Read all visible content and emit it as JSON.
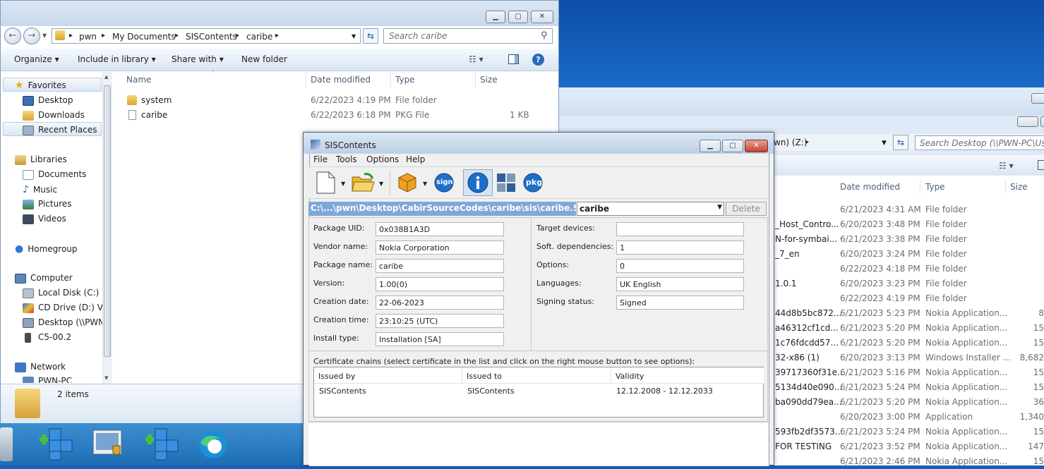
{
  "left_explorer": {
    "breadcrumbs": [
      "pwn",
      "My Documents",
      "SISContents",
      "caribe"
    ],
    "search_placeholder": "Search caribe",
    "commands": [
      "Organize",
      "Include in library",
      "Share with",
      "New folder"
    ],
    "nav": {
      "favorites": "Favorites",
      "favorites_items": [
        "Desktop",
        "Downloads",
        "Recent Places"
      ],
      "libraries": "Libraries",
      "libraries_items": [
        "Documents",
        "Music",
        "Pictures",
        "Videos"
      ],
      "homegroup": "Homegroup",
      "computer": "Computer",
      "computer_items": [
        "Local Disk (C:)",
        "CD Drive (D:) Virt",
        "Desktop (\\\\PWN-",
        "C5-00.2"
      ],
      "network": "Network",
      "network_items": [
        "PWN-PC"
      ]
    },
    "columns": {
      "name": "Name",
      "date": "Date modified",
      "type": "Type",
      "size": "Size"
    },
    "files": [
      {
        "name": "system",
        "date": "6/22/2023 4:19 PM",
        "type": "File folder",
        "size": ""
      },
      {
        "name": "caribe",
        "date": "6/22/2023 6:18 PM",
        "type": "PKG File",
        "size": "1 KB"
      }
    ],
    "status": "2 items"
  },
  "right_explorer": {
    "address_fragment": "wn) (Z:)",
    "search_placeholder": "Search Desktop (\\\\PWN-PC\\Users",
    "columns": {
      "date": "Date modified",
      "type": "Type",
      "size": "Size"
    },
    "rows": [
      {
        "name": "",
        "date": "6/21/2023 4:31 AM",
        "type": "File folder",
        "size": ""
      },
      {
        "name": "_Host_Contro...",
        "date": "6/20/2023 3:48 PM",
        "type": "File folder",
        "size": ""
      },
      {
        "name": "N-for-symbai...",
        "date": "6/21/2023 3:38 PM",
        "type": "File folder",
        "size": ""
      },
      {
        "name": "_7_en",
        "date": "6/20/2023 3:24 PM",
        "type": "File folder",
        "size": ""
      },
      {
        "name": "",
        "date": "6/22/2023 4:18 PM",
        "type": "File folder",
        "size": ""
      },
      {
        "name": "1.0.1",
        "date": "6/20/2023 3:23 PM",
        "type": "File folder",
        "size": ""
      },
      {
        "name": "",
        "date": "6/22/2023 4:19 PM",
        "type": "File folder",
        "size": ""
      },
      {
        "name": "44d8b5bc872...",
        "date": "6/21/2023 5:23 PM",
        "type": "Nokia Application...",
        "size": "8"
      },
      {
        "name": "a46312cf1cd...",
        "date": "6/21/2023 5:20 PM",
        "type": "Nokia Application...",
        "size": "15"
      },
      {
        "name": "1c76fdcdd57...",
        "date": "6/21/2023 5:20 PM",
        "type": "Nokia Application...",
        "size": "15"
      },
      {
        "name": "32-x86 (1)",
        "date": "6/20/2023 3:13 PM",
        "type": "Windows Installer ...",
        "size": "8,682"
      },
      {
        "name": "39717360f31e...",
        "date": "6/21/2023 5:16 PM",
        "type": "Nokia Application...",
        "size": "15"
      },
      {
        "name": "5134d40e090...",
        "date": "6/21/2023 5:24 PM",
        "type": "Nokia Application...",
        "size": "15"
      },
      {
        "name": "ba090dd79ea...",
        "date": "6/21/2023 5:20 PM",
        "type": "Nokia Application...",
        "size": "36"
      },
      {
        "name": "",
        "date": "6/20/2023 3:00 PM",
        "type": "Application",
        "size": "1,340"
      },
      {
        "name": "593fb2df3573...",
        "date": "6/21/2023 5:24 PM",
        "type": "Nokia Application...",
        "size": "15"
      },
      {
        "name": "FOR TESTING",
        "date": "6/21/2023 3:52 PM",
        "type": "Nokia Application...",
        "size": "147"
      },
      {
        "name": "",
        "date": "6/21/2023 2:46 PM",
        "type": "Nokia Application...",
        "size": "15"
      }
    ]
  },
  "sis": {
    "title": "SISContents",
    "menu": [
      "File",
      "Tools",
      "Options",
      "Help"
    ],
    "toolbar": {
      "sign": "sign",
      "pkg": "pkg"
    },
    "path": "C:\\...\\pwn\\Desktop\\CabirSourceCodes\\caribe\\sis\\caribe.SIS",
    "package_select": "caribe",
    "delete_label": "Delete",
    "left_props": [
      {
        "label": "Package UID:",
        "value": "0x038B1A3D"
      },
      {
        "label": "Vendor name:",
        "value": "Nokia Corporation"
      },
      {
        "label": "Package name:",
        "value": "caribe"
      },
      {
        "label": "Version:",
        "value": "1.00(0)"
      },
      {
        "label": "Creation date:",
        "value": "22-06-2023"
      },
      {
        "label": "Creation time:",
        "value": "23:10:25 (UTC)"
      },
      {
        "label": "Install type:",
        "value": "Installation [SA]"
      }
    ],
    "right_props": [
      {
        "label": "Target devices:",
        "value": ""
      },
      {
        "label": "Soft. dependencies:",
        "value": "1"
      },
      {
        "label": "Options:",
        "value": "0"
      },
      {
        "label": "Languages:",
        "value": "UK English"
      },
      {
        "label": "Signing status:",
        "value": "Signed"
      }
    ],
    "cert_label": "Certificate chains (select certificate in the list and click on the right mouse button to see options):",
    "cert_columns": [
      "Issued by",
      "Issued to",
      "Validity"
    ],
    "cert_rows": [
      {
        "issued_by": "SISContents",
        "issued_to": "SISContents",
        "validity": "12.12.2008 - 12.12.2033"
      }
    ]
  }
}
